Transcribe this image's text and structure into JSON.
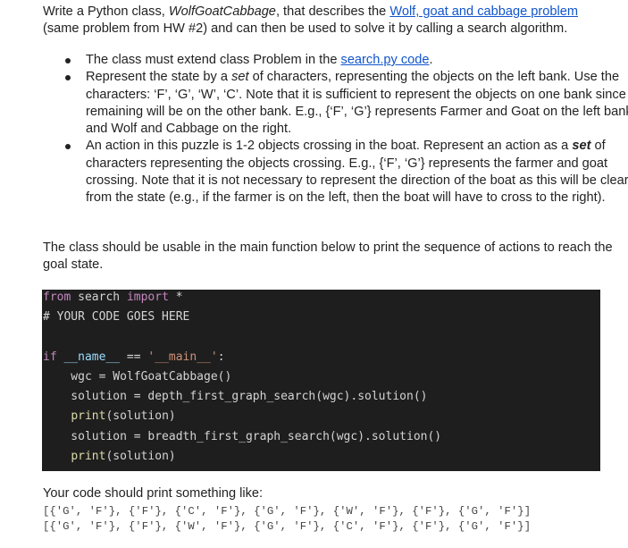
{
  "intro": {
    "text_before": "Write a Python class, ",
    "class_name": "WolfGoatCabbage",
    "text_middle": ", that describes the ",
    "link_text": "Wolf, goat and cabbage problem",
    "text_after": "(same problem from HW #2) and can then be used to solve it by calling a search algorithm."
  },
  "bullets": [
    {
      "before": "The class must extend class Problem in the ",
      "link": "search.py code",
      "after": "."
    },
    {
      "before": "Represent the state by a ",
      "em": "set",
      "after": " of characters, representing the objects on the left bank. Use the characters: ‘F’, ‘G’, ‘W’, ‘C’. Note that it is sufficient to represent the objects on one bank since the remaining will be on the other bank. E.g., {‘F’, ‘G’} represents Farmer and Goat on the left bank and Wolf and Cabbage on the right."
    },
    {
      "before": "An action in this puzzle is 1-2 objects crossing in the boat. Represent an action as a ",
      "strong_em": "set",
      "after": " of characters representing the objects crossing. E.g., {‘F’, ‘G’} represents the farmer and goat crossing. Note that it is not necessary to represent the direction of the boat as this will be clear from the state (e.g., if the farmer is on the left, then the boat will have to cross to the right)."
    }
  ],
  "usage_text": "The class should be usable in the main function below to print the sequence of actions to reach the goal state.",
  "code": {
    "l1_kw1": "from",
    "l1_mod": " search ",
    "l1_kw2": "import",
    "l1_rest": " *",
    "l2": "# YOUR CODE GOES HERE",
    "l4_kw": "if",
    "l4_var": "__name__",
    "l4_op": " == ",
    "l4_str": "'__main__'",
    "l4_colon": ":",
    "l5": "    wgc = WolfGoatCabbage()",
    "l6": "    solution = depth_first_graph_search(wgc).solution()",
    "l7_fn": "print",
    "l7_rest": "(solution)",
    "l8": "    solution = breadth_first_graph_search(wgc).solution()",
    "l9_fn": "print",
    "l9_rest": "(solution)"
  },
  "output_label": "Your code should print something like:",
  "output_lines": [
    "[{'G', 'F'}, {'F'}, {'C', 'F'}, {'G', 'F'}, {'W', 'F'}, {'F'}, {'G', 'F'}]",
    "[{'G', 'F'}, {'F'}, {'W', 'F'}, {'G', 'F'}, {'C', 'F'}, {'F'}, {'G', 'F'}]"
  ]
}
